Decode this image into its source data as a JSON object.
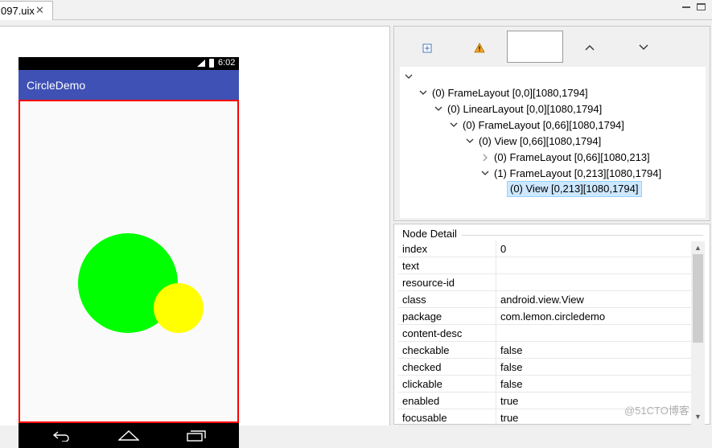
{
  "tab": {
    "label": "097.uix",
    "close": "✕"
  },
  "device": {
    "status_time": "6:02",
    "app_title": "CircleDemo",
    "colors": {
      "appbar": "#3f51b5",
      "big_circle": "#00ff00",
      "small_circle": "#ffff00",
      "selection": "#ff0000"
    }
  },
  "toolbar": {
    "expand_icon": "expand-all-icon",
    "warning_icon": "warning-icon",
    "filter_value": "",
    "up_icon": "chevron-up-icon",
    "down_icon": "chevron-down-icon"
  },
  "tree": {
    "nodes": [
      {
        "label": "(0) FrameLayout [0,0][1080,1794]"
      },
      {
        "label": "(0) LinearLayout [0,0][1080,1794]"
      },
      {
        "label": "(0) FrameLayout [0,66][1080,1794]"
      },
      {
        "label": "(0) View [0,66][1080,1794]"
      },
      {
        "label": "(0) FrameLayout [0,66][1080,213]"
      },
      {
        "label": "(1) FrameLayout [0,213][1080,1794]"
      },
      {
        "label": "(0) View [0,213][1080,1794]"
      }
    ]
  },
  "detail": {
    "title": "Node Detail",
    "rows": [
      {
        "key": "index",
        "value": "0"
      },
      {
        "key": "text",
        "value": ""
      },
      {
        "key": "resource-id",
        "value": ""
      },
      {
        "key": "class",
        "value": "android.view.View"
      },
      {
        "key": "package",
        "value": "com.lemon.circledemo"
      },
      {
        "key": "content-desc",
        "value": ""
      },
      {
        "key": "checkable",
        "value": "false"
      },
      {
        "key": "checked",
        "value": "false"
      },
      {
        "key": "clickable",
        "value": "false"
      },
      {
        "key": "enabled",
        "value": "true"
      },
      {
        "key": "focusable",
        "value": "true"
      }
    ]
  },
  "watermark": "@51CTO博客"
}
